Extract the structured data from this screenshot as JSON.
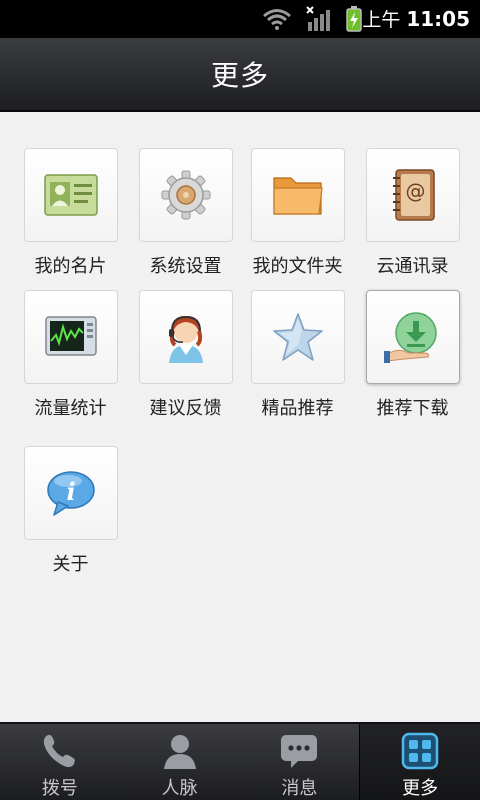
{
  "status_bar": {
    "ampm": "上午",
    "time": "11:05"
  },
  "header": {
    "title": "更多"
  },
  "grid": {
    "items": [
      {
        "label": "我的名片",
        "icon": "business-card-icon"
      },
      {
        "label": "系统设置",
        "icon": "gear-icon"
      },
      {
        "label": "我的文件夹",
        "icon": "folder-icon"
      },
      {
        "label": "云通讯录",
        "icon": "address-book-icon"
      },
      {
        "label": "流量统计",
        "icon": "traffic-monitor-icon"
      },
      {
        "label": "建议反馈",
        "icon": "support-agent-icon"
      },
      {
        "label": "精品推荐",
        "icon": "star-icon"
      },
      {
        "label": "推荐下载",
        "icon": "download-icon"
      },
      {
        "label": "关于",
        "icon": "info-icon"
      }
    ]
  },
  "tabs": [
    {
      "label": "拨号",
      "icon": "phone-icon"
    },
    {
      "label": "人脉",
      "icon": "contacts-icon"
    },
    {
      "label": "消息",
      "icon": "message-icon"
    },
    {
      "label": "更多",
      "icon": "grid-icon",
      "active": true
    }
  ],
  "colors": {
    "accent": "#4fb8ee",
    "header": "#2a2b2f",
    "background": "#f1f1f1"
  }
}
